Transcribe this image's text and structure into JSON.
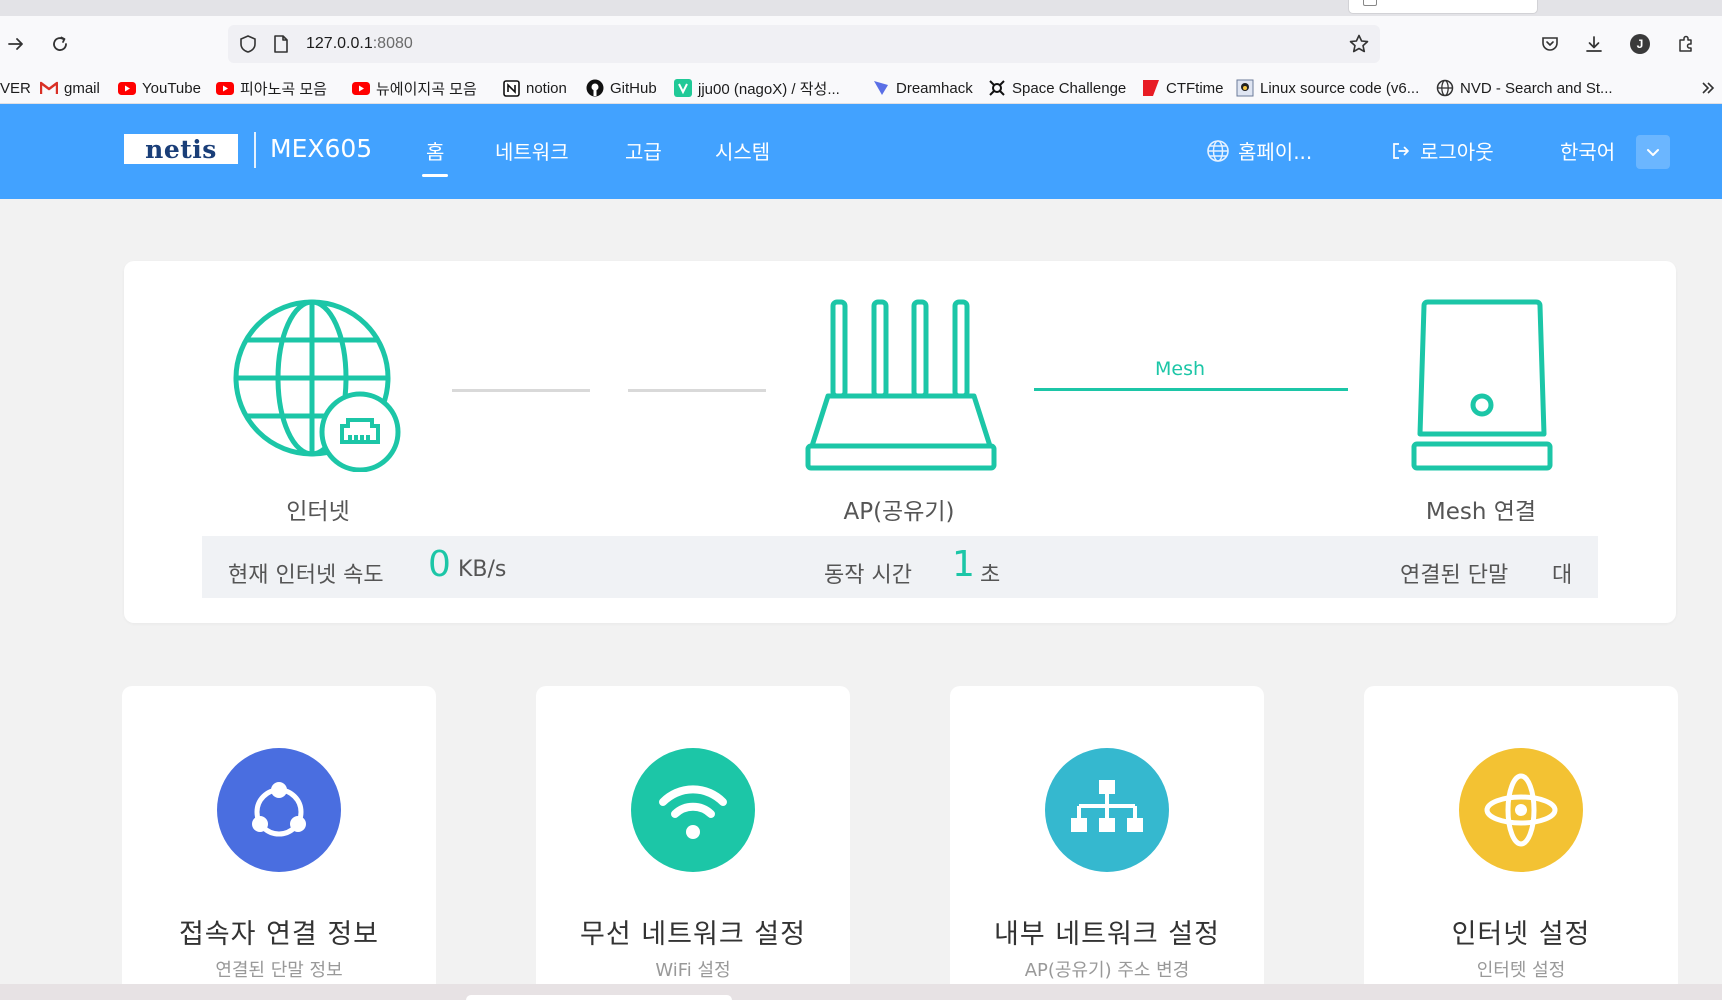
{
  "browser": {
    "url_host": "127.0.0.1",
    "url_port": ":8080",
    "bookmarks": [
      {
        "label": "VER",
        "icon": "naver-icon"
      },
      {
        "label": "gmail",
        "icon": "gmail-icon"
      },
      {
        "label": "YouTube",
        "icon": "youtube-icon"
      },
      {
        "label": "피아노곡 모음",
        "icon": "youtube-icon"
      },
      {
        "label": "뉴에이지곡 모음",
        "icon": "youtube-icon"
      },
      {
        "label": "notion",
        "icon": "notion-icon"
      },
      {
        "label": "GitHub",
        "icon": "github-icon"
      },
      {
        "label": "jju00 (nagoX) / 작성...",
        "icon": "velog-icon"
      },
      {
        "label": "Dreamhack",
        "icon": "dreamhack-icon"
      },
      {
        "label": "Space Challenge",
        "icon": "space-icon"
      },
      {
        "label": "CTFtime",
        "icon": "ctftime-icon"
      },
      {
        "label": "Linux source code (v6...",
        "icon": "linux-icon"
      },
      {
        "label": "NVD - Search and St...",
        "icon": "globe-icon"
      }
    ],
    "profile_initial": "J"
  },
  "header": {
    "logo": "netis",
    "model": "MEX605",
    "nav": [
      "홈",
      "네트워크",
      "고급",
      "시스템"
    ],
    "homepage": "홈페이...",
    "logout": "로그아웃",
    "language": "한국어"
  },
  "topology": {
    "internet_label": "인터넷",
    "ap_label": "AP(공유기)",
    "mesh_line_label": "Mesh",
    "mesh_label": "Mesh 연결"
  },
  "stats": {
    "speed_label": "현재 인터넷 속도",
    "speed_value": "0",
    "speed_unit": "KB/s",
    "uptime_label": "동작 시간",
    "uptime_value": "1",
    "uptime_unit": "초",
    "devices_label": "연결된 단말",
    "devices_unit": "대"
  },
  "cards": [
    {
      "title": "접속자 연결 정보",
      "subtitle": "연결된 단말 정보",
      "icon": "share-nodes-icon",
      "color": "#4a6ee0"
    },
    {
      "title": "무선 네트워크 설정",
      "subtitle": "WiFi 설정",
      "icon": "wifi-icon",
      "color": "#1cc6a7"
    },
    {
      "title": "내부 네트워크 설정",
      "subtitle": "AP(공유기) 주소 변경",
      "icon": "lan-tree-icon",
      "color": "#35b8cf"
    },
    {
      "title": "인터넷 설정",
      "subtitle": "인터텟 설정",
      "icon": "atom-icon",
      "color": "#f3c233"
    }
  ],
  "colors": {
    "header_blue": "#42a2ff",
    "teal": "#1cc6a7",
    "logo_navy": "#1a3e78"
  }
}
